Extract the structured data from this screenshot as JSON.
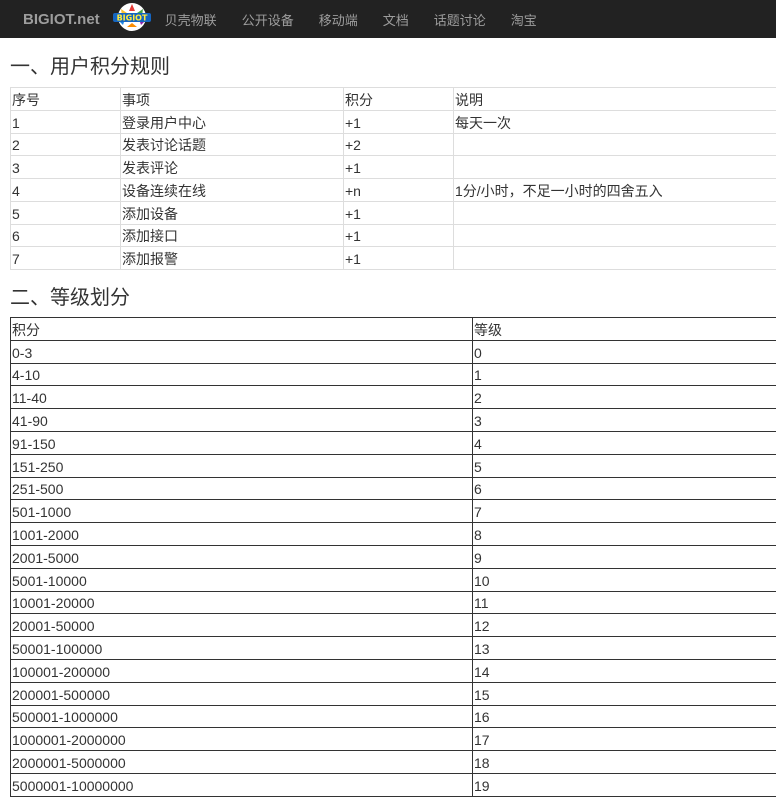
{
  "navbar": {
    "brand": "BIGIOT.net",
    "logo_text": "BIGIOT",
    "items": [
      {
        "label": "贝壳物联"
      },
      {
        "label": "公开设备"
      },
      {
        "label": "移动端"
      },
      {
        "label": "文档"
      },
      {
        "label": "话题讨论"
      },
      {
        "label": "淘宝"
      }
    ]
  },
  "section1": {
    "title": "一、用户积分规则",
    "headers": [
      "序号",
      "事项",
      "积分",
      "说明"
    ],
    "rows": [
      [
        "1",
        "登录用户中心",
        "+1",
        "每天一次"
      ],
      [
        "2",
        "发表讨论话题",
        "+2",
        ""
      ],
      [
        "3",
        "发表评论",
        "+1",
        ""
      ],
      [
        "4",
        "设备连续在线",
        "+n",
        "1分/小时，不足一小时的四舍五入"
      ],
      [
        "5",
        "添加设备",
        "+1",
        ""
      ],
      [
        "6",
        "添加接口",
        "+1",
        ""
      ],
      [
        "7",
        "添加报警",
        "+1",
        ""
      ]
    ]
  },
  "section2": {
    "title": "二、等级划分",
    "headers": [
      "积分",
      "等级"
    ],
    "rows": [
      [
        "0-3",
        "0"
      ],
      [
        "4-10",
        "1"
      ],
      [
        "11-40",
        "2"
      ],
      [
        "41-90",
        "3"
      ],
      [
        "91-150",
        "4"
      ],
      [
        "151-250",
        "5"
      ],
      [
        "251-500",
        "6"
      ],
      [
        "501-1000",
        "7"
      ],
      [
        "1001-2000",
        "8"
      ],
      [
        "2001-5000",
        "9"
      ],
      [
        "5001-10000",
        "10"
      ],
      [
        "10001-20000",
        "11"
      ],
      [
        "20001-50000",
        "12"
      ],
      [
        "50001-100000",
        "13"
      ],
      [
        "100001-200000",
        "14"
      ],
      [
        "200001-500000",
        "15"
      ],
      [
        "500001-1000000",
        "16"
      ],
      [
        "1000001-2000000",
        "17"
      ],
      [
        "2000001-5000000",
        "18"
      ],
      [
        "5000001-10000000",
        "19"
      ]
    ]
  }
}
